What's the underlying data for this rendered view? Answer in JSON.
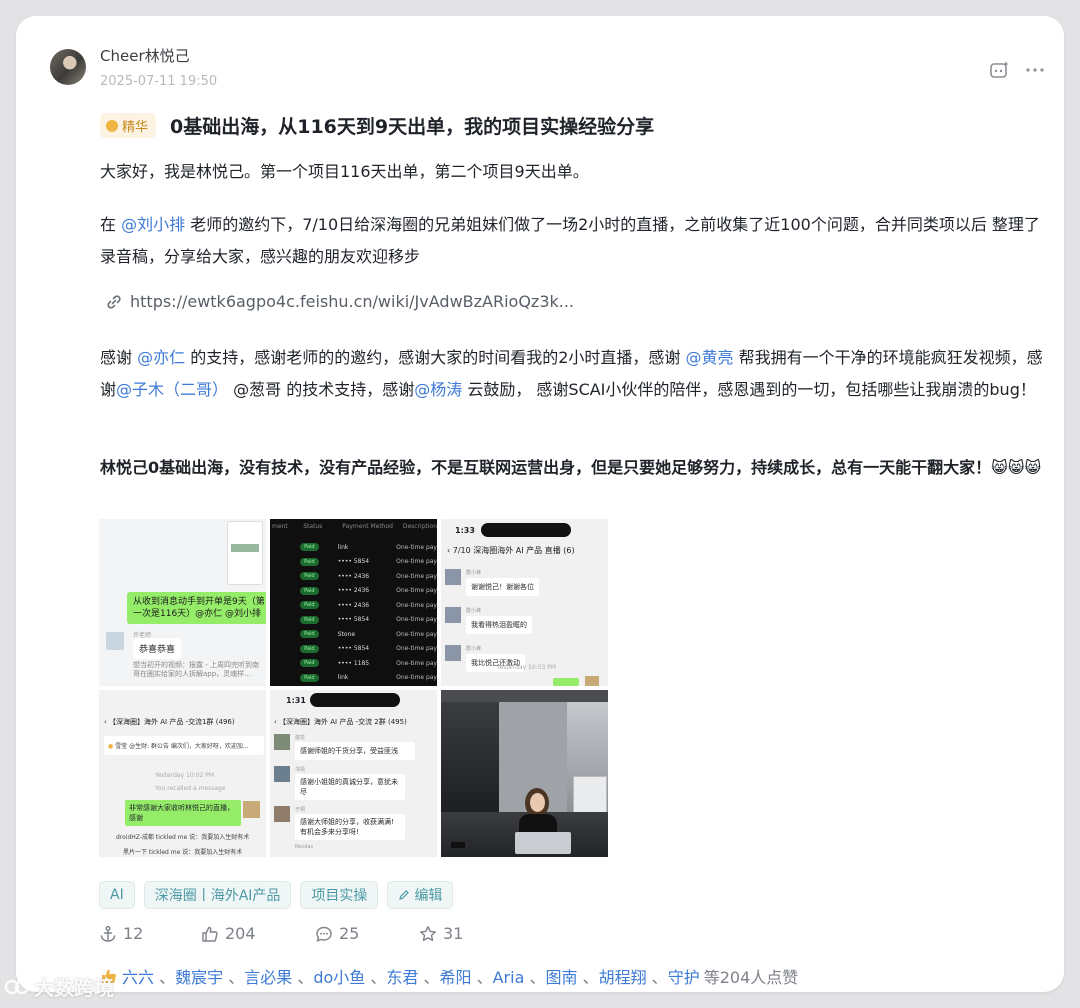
{
  "post": {
    "author": "Cheer林悦己",
    "timestamp": "2025-07-11 19:50",
    "badge": "精华",
    "title": "0基础出海，从116天到9天出单，我的项目实操经验分享",
    "p1": "大家好，我是林悦己。第一个项目116天出单，第二个项目9天出单。",
    "p2": {
      "pre": "在 ",
      "mention": "@刘小排",
      "post": "   老师的邀约下，7/10日给深海圈的兄弟姐妹们做了一场2小时的直播，之前收集了近100个问题，合并同类项以后 整理了录音稿，分享给大家，感兴趣的朋友欢迎移步"
    },
    "link": "https://ewtk6agpo4c.feishu.cn/wiki/JvAdwBzARioQz3k...",
    "p3": {
      "t1": "感谢 ",
      "m1": "@亦仁",
      "t2": "  的支持，感谢老师的的邀约，感谢大家的时间看我的2小时直播，感谢 ",
      "m2": "@黄亮",
      "t3": "  帮我拥有一个干净的环境能疯狂发视频，感谢",
      "m3": "@子木（二哥）",
      "t4": "    @葱哥  的技术支持，感谢",
      "m4": "@杨涛",
      "t5": "  云鼓励， 感谢SCAI小伙伴的陪伴，感恩遇到的一切，包括哪些让我崩溃的bug！"
    },
    "p4": "林悦己0基础出海，没有技术，没有产品经验，不是互联网运营出身，但是只要她足够努力，持续成长，总有一天能干翻大家！",
    "p4_emoji": "😸😸😸"
  },
  "images": {
    "img1": {
      "green_msg": "从收到消息动手到开单是9天（第一次是116天）@亦仁 @刘小排",
      "sender": "许老师",
      "reply": "恭喜恭喜",
      "grey_text": "想当初开的视频：报露 - 上周四完听到南哥在圈实给家的人拆解app，灵魂样..."
    },
    "img2": {
      "headers": [
        "ment",
        "Status",
        "Payment Method",
        "Description"
      ],
      "rows": [
        [
          "Paid",
          "link",
          "One-time pay"
        ],
        [
          "Paid",
          "•••• 5854",
          "One-time pay"
        ],
        [
          "Paid",
          "•••• 2436",
          "One-time pay"
        ],
        [
          "Paid",
          "•••• 2436",
          "One-time pay"
        ],
        [
          "Paid",
          "•••• 2436",
          "One-time pay"
        ],
        [
          "Paid",
          "•••• 5854",
          "One-time pay"
        ],
        [
          "Paid",
          "Stone",
          "One-time pay"
        ],
        [
          "Paid",
          "•••• 5854",
          "One-time pay"
        ],
        [
          "Paid",
          "•••• 1185",
          "One-time pay"
        ],
        [
          "Paid",
          "link",
          "One-time pay"
        ]
      ]
    },
    "img3": {
      "time": "1:33",
      "chat_title": "7/10 深海圈海外 AI 产品 直播 (6)",
      "sender": "群小蜂",
      "msgs": [
        "谢谢悦己！谢谢各位",
        "我看得热泪盈眶的",
        "我比悦己还激动"
      ],
      "footer": "Yesterday 10:03 PM"
    },
    "img4": {
      "chat_title": "【深海圈】海外 AI 产品 -交流1群 (496)",
      "notice": "雪莹 @生财: 群公告 编次们，大家好呀，欢迎加...",
      "time_label": "Yesterday 10:02 PM",
      "recalled": "You recalled a message",
      "green_msg": "非常感谢大家收听林悦己的直播，感谢",
      "tickle1": "droidHZ-成都 tickled me  说：我要加入生财有术",
      "tickle2": "黑片一下 tickled me  说：我要加入生财有术"
    },
    "img5": {
      "time": "1:31",
      "chat_title": "【深海圈】海外 AI 产品 -交流 2群 (495)",
      "msgs": [
        {
          "name": "建龙",
          "text": "感谢师姐的干货分享，受益匪浅"
        },
        {
          "name": "书情",
          "text": "感谢小姐姐的真诚分享，意犹未尽"
        },
        {
          "name": "于桐",
          "text": "感谢大师姐的分享，收获满满! 有机会多来分享呀!"
        }
      ],
      "last_name": "Nicolas"
    }
  },
  "tags": [
    "AI",
    "深海圈丨海外AI产品",
    "项目实操",
    "编辑"
  ],
  "stats": {
    "shares": "12",
    "likes": "204",
    "comments": "25",
    "favorites": "31"
  },
  "likers": [
    "六六",
    "魏宸宇",
    "言必果",
    "do小鱼",
    "东君",
    "希阳",
    "Aria",
    "图南",
    "胡程翔",
    "守护"
  ],
  "likers_total": "等204人点赞",
  "watermark": "大数跨境"
}
